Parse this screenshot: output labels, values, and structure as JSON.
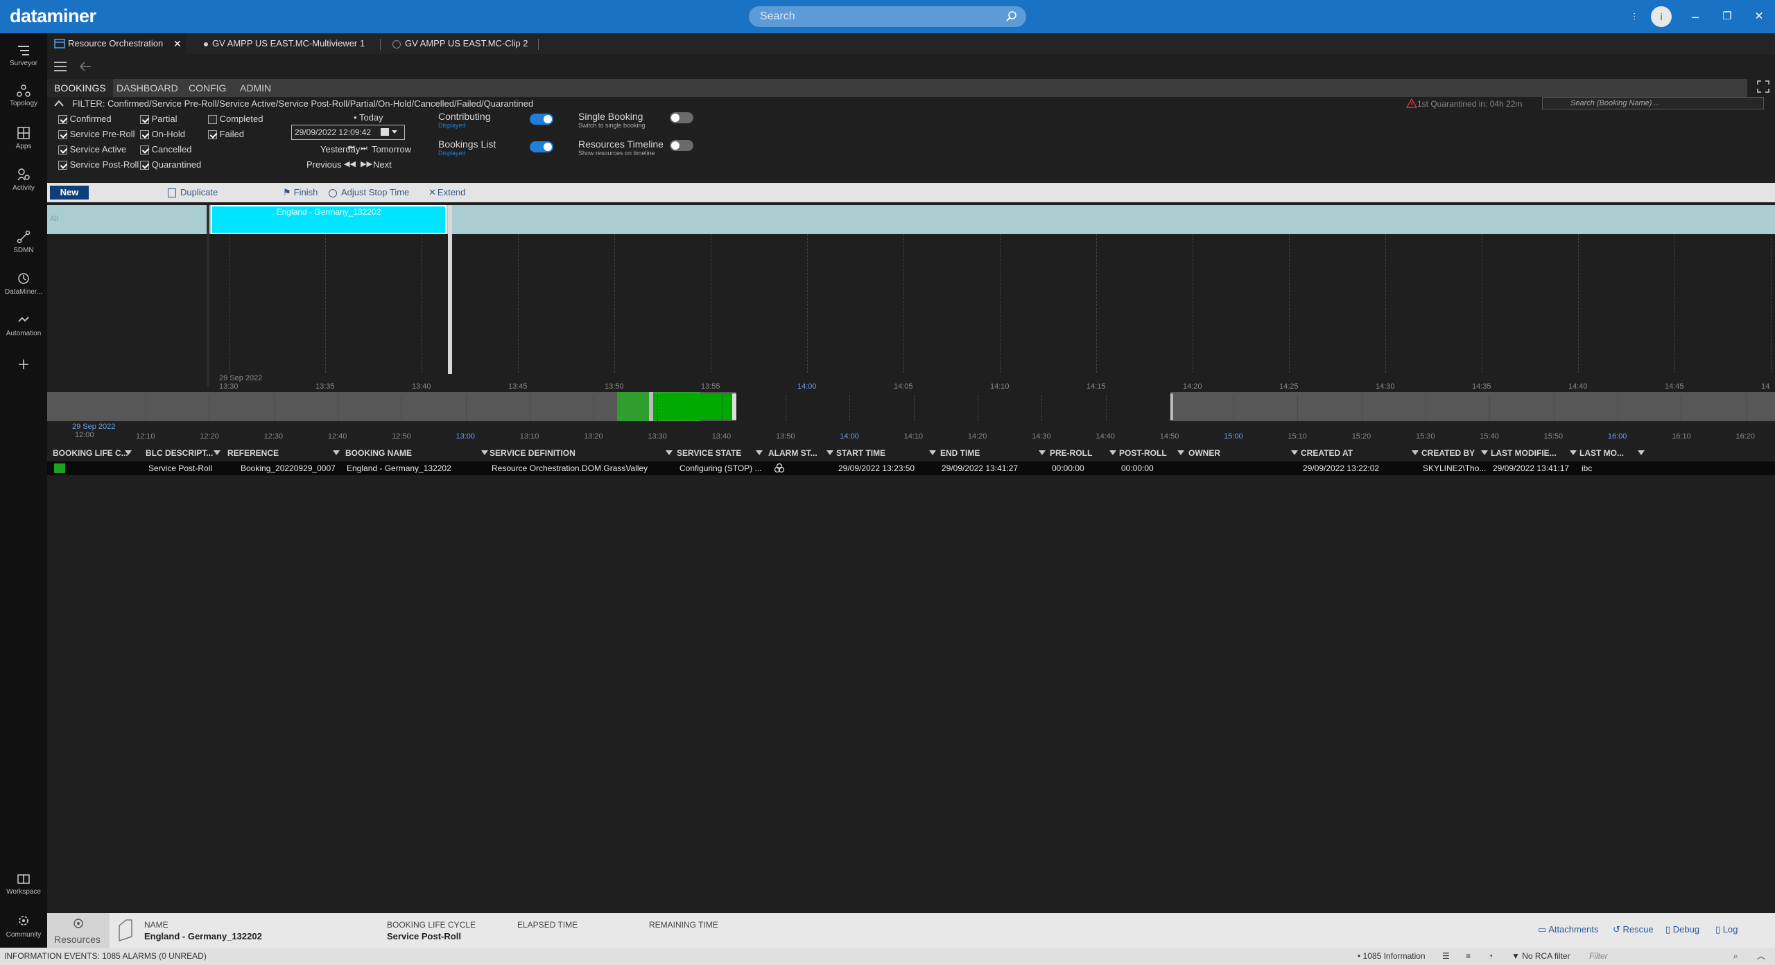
{
  "app": {
    "logo": "dataminer",
    "search_placeholder": "Search",
    "avatar_initial": "i",
    "win_min": "–",
    "win_restore": "❐",
    "win_close": "✕",
    "win_pin": "⫶"
  },
  "leftnav": [
    {
      "label": "Surveyor"
    },
    {
      "label": "Topology"
    },
    {
      "label": "Apps"
    },
    {
      "label": "Activity"
    },
    {
      "label": "SDMN"
    },
    {
      "label": "DataMiner..."
    },
    {
      "label": "Automation"
    },
    {
      "label": "Workspace"
    },
    {
      "label": "Community"
    }
  ],
  "tabs": [
    {
      "label": "Resource Orchestration",
      "close": "✕"
    },
    {
      "label": "GV AMPP US EAST.MC-Multiviewer 1"
    },
    {
      "label": "GV AMPP US EAST.MC-Clip 2"
    }
  ],
  "modtabs": [
    "BOOKINGS",
    "DASHBOARD",
    "CONFIG",
    "ADMIN"
  ],
  "filter": {
    "text": "FILTER: Confirmed/Service Pre-Roll/Service Active/Service Post-Roll/Partial/On-Hold/Cancelled/Failed/Quarantined",
    "quarantine_warning": "1st Quarantined in: 04h 22m",
    "search_placeholder": "Search (Booking Name) ...",
    "checkboxes_col1": [
      {
        "label": "Confirmed",
        "checked": true
      },
      {
        "label": "Service Pre-Roll",
        "checked": true
      },
      {
        "label": "Service Active",
        "checked": true
      },
      {
        "label": "Service Post-Roll",
        "checked": true
      }
    ],
    "checkboxes_col2": [
      {
        "label": "Partial",
        "checked": true
      },
      {
        "label": "On-Hold",
        "checked": true
      },
      {
        "label": "Cancelled",
        "checked": true
      },
      {
        "label": "Quarantined",
        "checked": true
      }
    ],
    "checkboxes_col3": [
      {
        "label": "Completed",
        "checked": false
      },
      {
        "label": "Failed",
        "checked": true
      }
    ],
    "date": {
      "today": "Today",
      "value": "29/09/2022 12:09:42",
      "yesterday": "Yesterday",
      "tomorrow": "Tomorrow",
      "previous": "Previous",
      "next": "Next"
    },
    "toggles": [
      {
        "label": "Contributing",
        "sub": "Displayed",
        "on": true
      },
      {
        "label": "Bookings List",
        "sub": "Displayed",
        "on": true
      },
      {
        "label": "Single Booking",
        "sub": "Switch to single booking",
        "on": false
      },
      {
        "label": "Resources Timeline",
        "sub": "Show resources on timeline",
        "on": false
      }
    ]
  },
  "toolbar": {
    "new": "New",
    "duplicate": "Duplicate",
    "finish": "Finish",
    "adjust_stop": "Adjust Stop Time",
    "extend": "Extend"
  },
  "timeline": {
    "lane_label": "All",
    "booking_label": "England - Germany_132202",
    "date_label": "29 Sep 2022",
    "ticks": [
      "13:30",
      "13:35",
      "13:40",
      "13:45",
      "13:50",
      "13:55",
      "14:00",
      "14:05",
      "14:10",
      "14:15",
      "14:20",
      "14:25",
      "14:30",
      "14:35",
      "14:40",
      "14:45",
      "14"
    ]
  },
  "overview": {
    "date_label": "29 Sep 2022",
    "first_tick": "12:00",
    "ticks": [
      "12:10",
      "12:20",
      "12:30",
      "12:40",
      "12:50",
      "13:00",
      "13:10",
      "13:20",
      "13:30",
      "13:40",
      "13:50",
      "14:00",
      "14:10",
      "14:20",
      "14:30",
      "14:40",
      "14:50",
      "15:00",
      "15:10",
      "15:20",
      "15:30",
      "15:40",
      "15:50",
      "16:00",
      "16:10",
      "16:20"
    ]
  },
  "table": {
    "headers": [
      "BOOKING LIFE C...",
      "BLC DESCRIPT...",
      "REFERENCE",
      "BOOKING NAME",
      "SERVICE DEFINITION",
      "SERVICE STATE",
      "ALARM ST...",
      "START TIME",
      "END TIME",
      "PRE-ROLL",
      "POST-ROLL",
      "OWNER",
      "CREATED AT",
      "CREATED BY",
      "LAST MODIFIE...",
      "LAST MO..."
    ],
    "rows": [
      {
        "blc_color": "#1ea11e",
        "blc_desc": "Service Post-Roll",
        "reference": "Booking_20220929_0007",
        "name": "England - Germany_132202",
        "service_def": "Resource Orchestration.DOM.GrassValley",
        "service_state": "Configuring (STOP) ...",
        "start": "29/09/2022 13:23:50",
        "end": "29/09/2022 13:41:27",
        "preroll": "00:00:00",
        "postroll": "00:00:00",
        "owner": "",
        "created_at": "29/09/2022 13:22:02",
        "created_by": "SKYLINE2\\Tho...",
        "last_modified": "29/09/2022 13:41:17",
        "last_mod_by": "ibc"
      }
    ]
  },
  "bottom": {
    "resources": "Resources",
    "name_label": "NAME",
    "name_value": "England - Germany_132202",
    "blc_label": "BOOKING LIFE CYCLE",
    "blc_value": "Service Post-Roll",
    "elapsed_label": "ELAPSED TIME",
    "remaining_label": "REMAINING TIME",
    "attachments": "Attachments",
    "rescue": "Rescue",
    "debug": "Debug",
    "log": "Log"
  },
  "status": {
    "left": "INFORMATION EVENTS: 1085 ALARMS (0 UNREAD)",
    "info": "1085 Information",
    "rca": "No RCA filter",
    "filter_placeholder": "Filter"
  }
}
